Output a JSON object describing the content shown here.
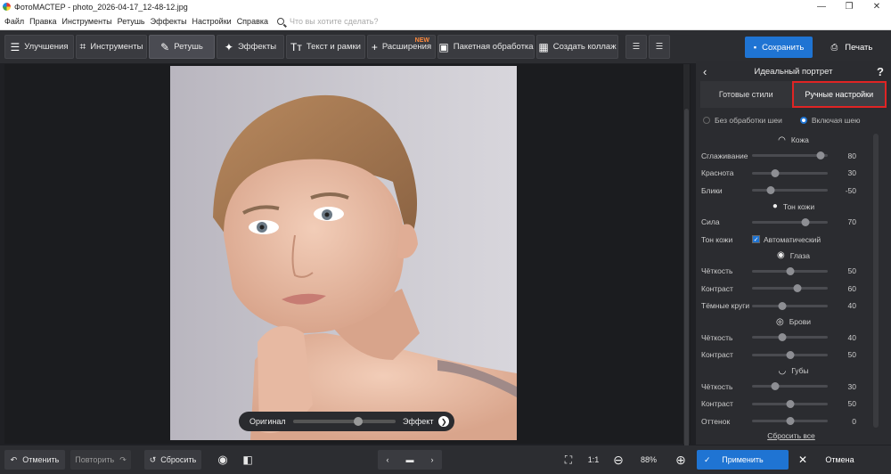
{
  "title": "ФотоМАСТЕР - photo_2026-04-17_12-48-12.jpg",
  "menu": [
    "Файл",
    "Правка",
    "Инструменты",
    "Ретушь",
    "Эффекты",
    "Настройки",
    "Справка"
  ],
  "search_placeholder": "Что вы хотите сделать?",
  "toolbar": {
    "improve": "Улучшения",
    "tools": "Инструменты",
    "retouch": "Ретушь",
    "effects": "Эффекты",
    "text": "Текст и рамки",
    "extensions": "Расширения",
    "new_badge": "NEW",
    "batch": "Пакетная обработка",
    "collage": "Создать коллаж",
    "save": "Сохранить",
    "print": "Печать"
  },
  "compare": {
    "original": "Оригинал",
    "effect": "Эффект",
    "position": 0.62
  },
  "panel": {
    "title": "Идеальный портрет",
    "help": "?",
    "tabs": [
      "Готовые стили",
      "Ручные настройки"
    ],
    "radio_without": "Без обработки шеи",
    "radio_with": "Включая шею",
    "skin": "Кожа",
    "smoothing": "Сглаживание",
    "smoothing_val": "80",
    "redness": "Краснота",
    "redness_val": "30",
    "glare": "Блики",
    "glare_val": "-50",
    "skin_tone": "Тон кожи",
    "strength": "Сила",
    "strength_val": "70",
    "tone_label": "Тон кожи",
    "auto": "Автоматический",
    "eyes": "Глаза",
    "eye_clarity": "Чёткость",
    "eye_clarity_val": "50",
    "eye_contrast": "Контраст",
    "eye_contrast_val": "60",
    "dark_circles": "Тёмные круги",
    "dark_circles_val": "40",
    "brows": "Брови",
    "brow_clarity": "Чёткость",
    "brow_clarity_val": "40",
    "brow_contrast": "Контраст",
    "brow_contrast_val": "50",
    "lips": "Губы",
    "lip_clarity": "Чёткость",
    "lip_clarity_val": "30",
    "lip_contrast": "Контраст",
    "lip_contrast_val": "50",
    "lip_tint": "Оттенок",
    "lip_tint_val": "0",
    "reset_all": "Сбросить все"
  },
  "bottom": {
    "undo": "Отменить",
    "redo": "Повторить",
    "reset": "Сбросить",
    "ratio": "1:1",
    "zoom": "88%",
    "apply": "Применить",
    "cancel": "Отмена"
  }
}
